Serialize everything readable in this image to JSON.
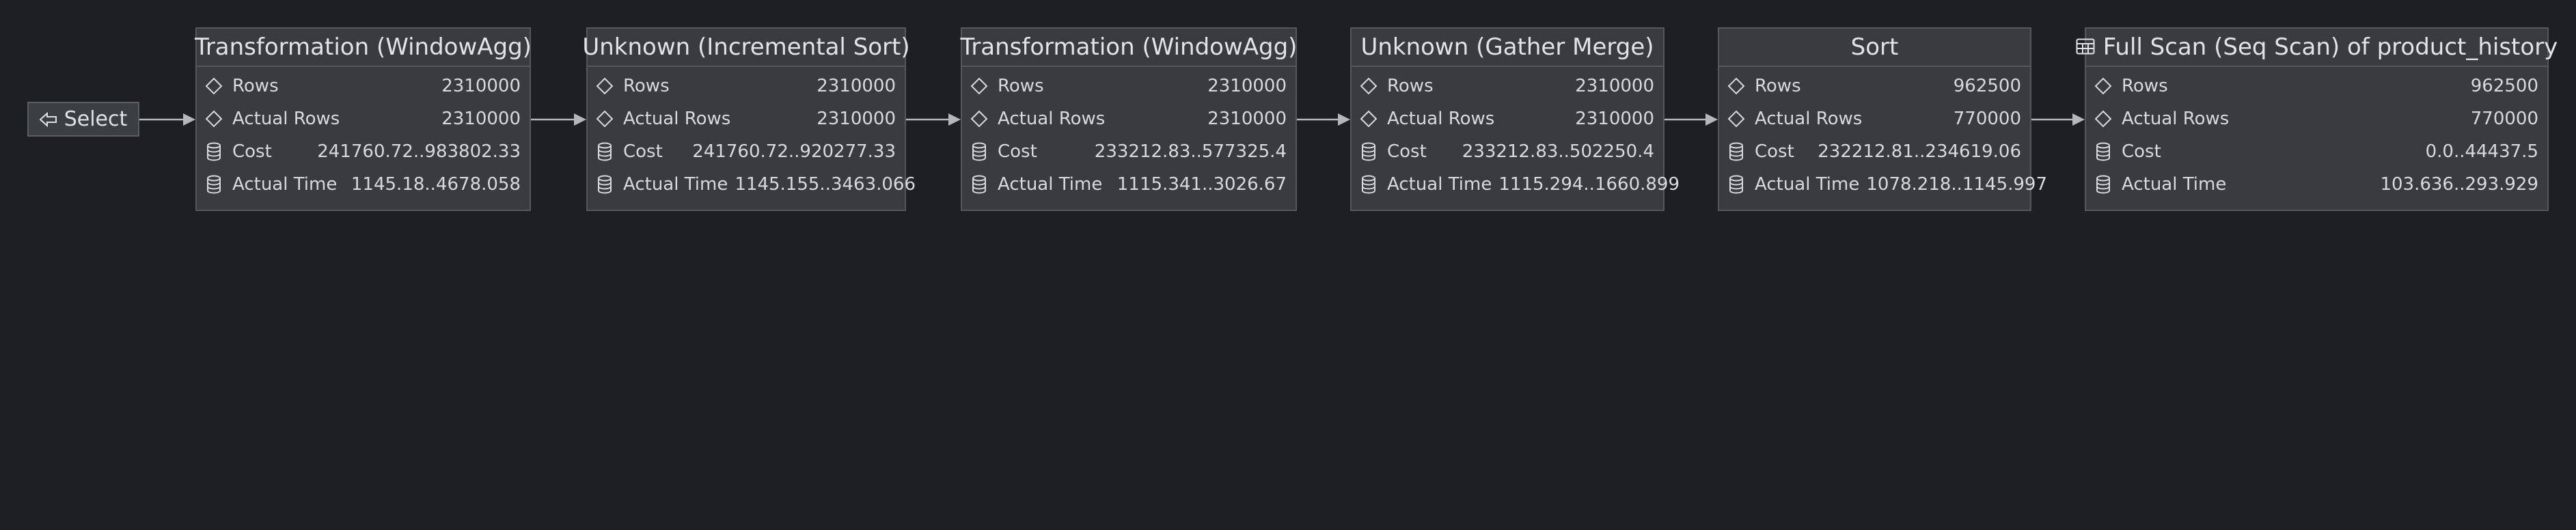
{
  "select_node": {
    "label": "Select",
    "icon": "arrow-left-icon"
  },
  "row_labels": {
    "rows": "Rows",
    "actual_rows": "Actual Rows",
    "cost": "Cost",
    "actual_time": "Actual Time"
  },
  "nodes": [
    {
      "title": "Transformation (WindowAgg)",
      "icon": "",
      "rows": "2310000",
      "actual_rows": "2310000",
      "cost": "241760.72..983802.33",
      "actual_time": "1145.18..4678.058"
    },
    {
      "title": "Unknown (Incremental Sort)",
      "icon": "",
      "rows": "2310000",
      "actual_rows": "2310000",
      "cost": "241760.72..920277.33",
      "actual_time": "1145.155..3463.066"
    },
    {
      "title": "Transformation (WindowAgg)",
      "icon": "",
      "rows": "2310000",
      "actual_rows": "2310000",
      "cost": "233212.83..577325.4",
      "actual_time": "1115.341..3026.67"
    },
    {
      "title": "Unknown (Gather Merge)",
      "icon": "",
      "rows": "2310000",
      "actual_rows": "2310000",
      "cost": "233212.83..502250.4",
      "actual_time": "1115.294..1660.899"
    },
    {
      "title": "Sort",
      "icon": "",
      "rows": "962500",
      "actual_rows": "770000",
      "cost": "232212.81..234619.06",
      "actual_time": "1078.218..1145.997"
    },
    {
      "title": "Full Scan (Seq Scan) of product_history",
      "icon": "table-icon",
      "rows": "962500",
      "actual_rows": "770000",
      "cost": "0.0..44437.5",
      "actual_time": "103.636..293.929"
    }
  ],
  "colors": {
    "background": "#1e1f22",
    "node_fill": "#393b3e",
    "node_border": "#55585b",
    "text": "#dfe1e5",
    "edge": "#b5b7ba"
  }
}
